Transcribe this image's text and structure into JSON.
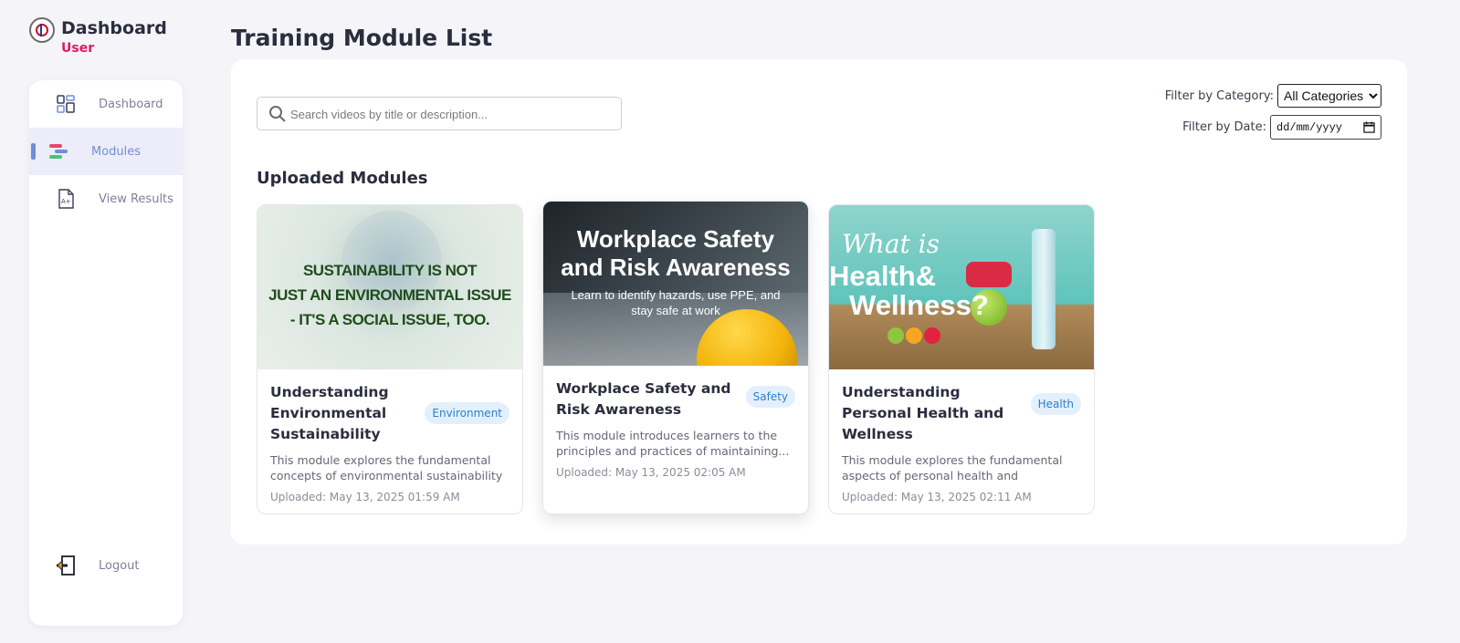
{
  "brand": {
    "title": "Dashboard",
    "role": "User"
  },
  "sidebar": {
    "items": [
      {
        "label": "Dashboard",
        "icon": "dashboard-icon"
      },
      {
        "label": "Modules",
        "icon": "modules-icon",
        "active": true
      },
      {
        "label": "View Results",
        "icon": "results-icon"
      }
    ],
    "logout": {
      "label": "Logout",
      "icon": "logout-icon"
    }
  },
  "page": {
    "title": "Training Module List"
  },
  "search": {
    "placeholder": "Search videos by title or description..."
  },
  "filters": {
    "category_label": "Filter by Category:",
    "category_selected": "All Categories",
    "date_label": "Filter by Date:",
    "date_placeholder": "dd/mm/yyyy"
  },
  "section": {
    "title": "Uploaded Modules"
  },
  "modules": [
    {
      "title": "Understanding Environmental Sustainability",
      "category": "Environment",
      "description": "This module explores the fundamental concepts of environmental sustainability",
      "uploaded": "Uploaded: May 13, 2025 01:59 AM",
      "thumb_text": [
        "SUSTAINABILITY IS NOT",
        "JUST AN ENVIRONMENTAL ISSUE",
        "- IT'S A SOCIAL ISSUE, TOO."
      ]
    },
    {
      "title": "Workplace Safety and Risk Awareness",
      "category": "Safety",
      "description": "This module introduces learners to the principles and practices of maintaining...",
      "uploaded": "Uploaded: May 13, 2025 02:05 AM",
      "thumb_text": [
        "Workplace Safety",
        "and Risk Awareness",
        "Learn to identify hazards, use PPE, and",
        "stay safe at work"
      ]
    },
    {
      "title": "Understanding Personal Health and Wellness",
      "category": "Health",
      "description": "This module explores the fundamental aspects of personal health and wellness...",
      "uploaded": "Uploaded: May 13, 2025 02:11 AM",
      "thumb_text": [
        "What is",
        "Health&",
        "Wellness?"
      ]
    }
  ],
  "colors": {
    "accent": "#6f8ed8",
    "role": "#e5175f",
    "badge_bg": "#e3f0fc",
    "badge_text": "#2b7fd1"
  }
}
